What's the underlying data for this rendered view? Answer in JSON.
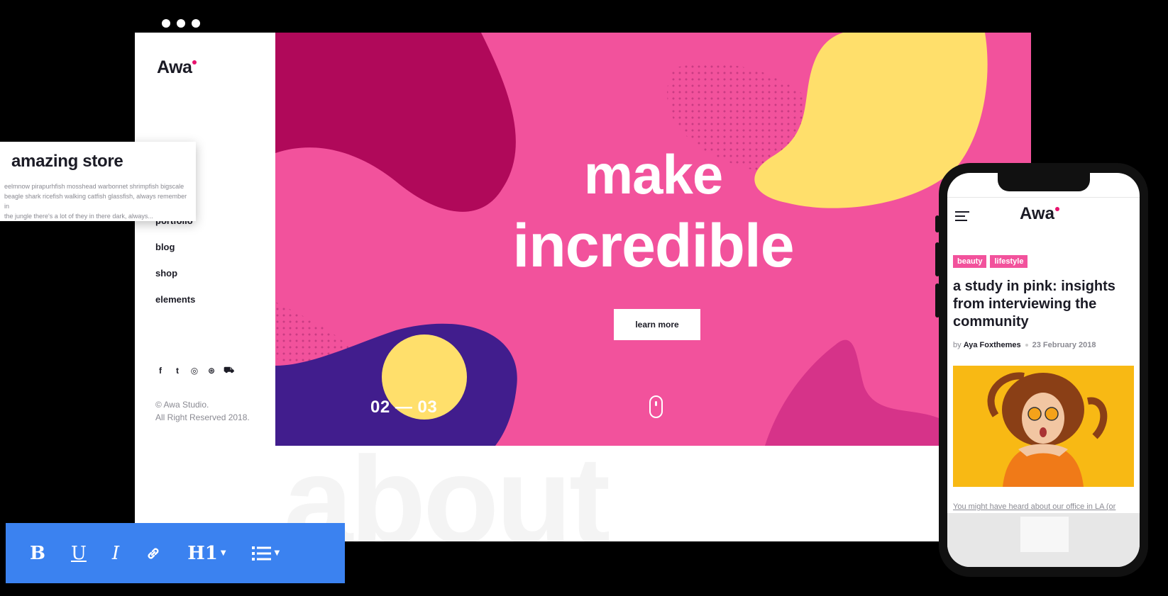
{
  "brand": {
    "logo": "Awa",
    "accent": "#f2529c",
    "dot_color": "#e8136d"
  },
  "sidebar": {
    "nav": [
      {
        "label": "portfolio"
      },
      {
        "label": "blog"
      },
      {
        "label": "shop"
      },
      {
        "label": "elements"
      }
    ],
    "social_icons": [
      "facebook-icon",
      "twitter-icon",
      "instagram-icon",
      "dribbble-icon",
      "cart-icon"
    ],
    "copyright_line1": "© Awa Studio.",
    "copyright_line2": "All Right Reserved 2018."
  },
  "hero": {
    "title_line1": "make",
    "title_line2": "incredible",
    "button": "learn more",
    "counter": "02 — 03",
    "colors": {
      "bg": "#f2529c",
      "crimson": "#b0095a",
      "yellow": "#ffdf6b",
      "purple": "#411d8d",
      "magenta": "#d63389"
    }
  },
  "ghost_heading": "about",
  "store_card": {
    "title": "amazing store",
    "text_line1": "eelmnow pirapurhfish mosshead warbonnet shrimpfish bigscale",
    "text_line2": "beagle shark ricefish walking catfish glassfish, always remember in",
    "text_line3": "the jungle there's a lot of they in there dark, always..."
  },
  "toolbar": {
    "bold": "B",
    "underline": "U",
    "italic": "I",
    "heading": "H1",
    "color": "#3b82f0",
    "icons": [
      "bold-icon",
      "underline-icon",
      "italic-icon",
      "link-icon",
      "heading-icon",
      "list-icon"
    ]
  },
  "mobile": {
    "logo": "Awa",
    "tags": [
      "beauty",
      "lifestyle"
    ],
    "title": "a study in pink: insights from interviewing the community",
    "by": "by",
    "author": "Aya Foxthemes",
    "date": "23 February 2018",
    "excerpt": "You might have heard about our office in LA (or"
  }
}
